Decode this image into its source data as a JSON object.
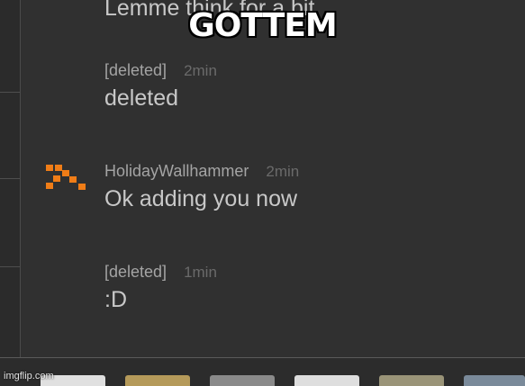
{
  "caption": "GOTTEM",
  "watermark": "imgflip.com",
  "messages": [
    {
      "author": "",
      "time": "",
      "text": "Lemme think for a bit"
    },
    {
      "author": "[deleted]",
      "time": "2min",
      "text": "deleted"
    },
    {
      "author": "HolidayWallhammer",
      "time": "2min",
      "text": "Ok adding you now"
    },
    {
      "author": "[deleted]",
      "time": "1min",
      "text": ":D"
    }
  ],
  "avatar": {
    "icon": "pickaxe-icon",
    "color": "#f07d17"
  },
  "colors": {
    "background": "#303030",
    "author": "#a4a4a4",
    "time": "#6a6a6a",
    "body": "#c8c8c8"
  },
  "emoji_tray": {
    "thumbnails": [
      "#e0e0e0",
      "#b59a5a",
      "#8a8a8a",
      "#dedede",
      "#9a9478",
      "#7a8a9a"
    ]
  }
}
